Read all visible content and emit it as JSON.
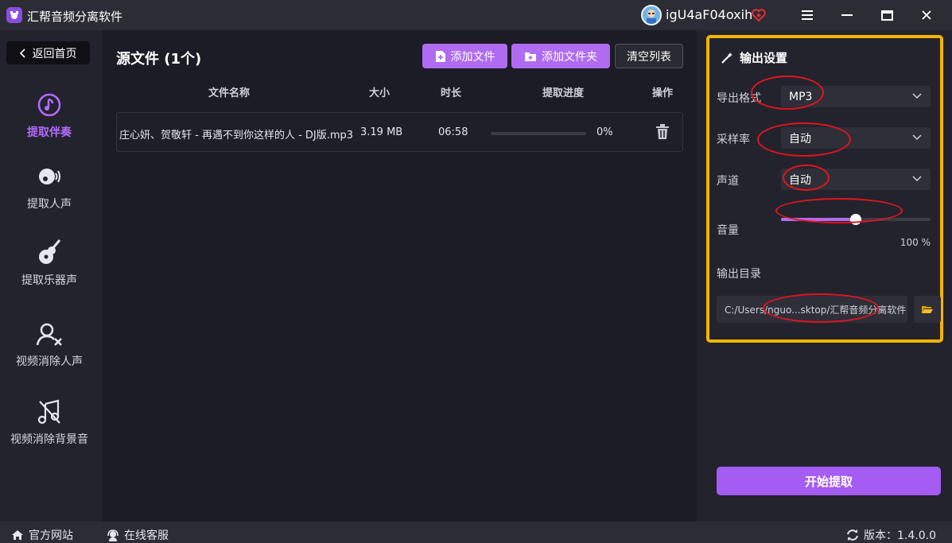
{
  "app": {
    "title": "汇帮音频分离软件"
  },
  "user": {
    "name": "igU4aF04oxih"
  },
  "sidebar": {
    "back_label": "返回首页",
    "items": [
      {
        "label": "提取伴奏",
        "icon": "music-note-icon",
        "active": true
      },
      {
        "label": "提取人声",
        "icon": "voice-icon",
        "active": false
      },
      {
        "label": "提取乐器声",
        "icon": "guitar-icon",
        "active": false
      },
      {
        "label": "视频消除人声",
        "icon": "user-remove-icon",
        "active": false
      },
      {
        "label": "视频消除背景音",
        "icon": "music-off-icon",
        "active": false
      }
    ]
  },
  "main": {
    "title": "源文件 (1个)",
    "buttons": {
      "add_file": "添加文件",
      "add_folder": "添加文件夹",
      "clear_list": "清空列表"
    },
    "columns": {
      "name": "文件名称",
      "size": "大小",
      "duration": "时长",
      "progress": "提取进度",
      "action": "操作"
    },
    "files": [
      {
        "name": "庄心妍、贺敬轩 - 再遇不到你这样的人 - DJ版.mp3",
        "size": "3.19 MB",
        "duration": "06:58",
        "progress_text": "0%",
        "progress": 0
      }
    ]
  },
  "settings": {
    "title": "输出设置",
    "format_label": "导出格式",
    "format_value": "MP3",
    "sample_rate_label": "采样率",
    "sample_rate_value": "自动",
    "channel_label": "声道",
    "channel_value": "自动",
    "volume_label": "音量",
    "volume_text": "100 %",
    "volume_fraction": 0.5,
    "output_dir_label": "输出目录",
    "output_dir_value": "C:/Users/nguo...sktop/汇帮音频分离软件"
  },
  "start_button": "开始提取",
  "footer": {
    "website": "官方网站",
    "support": "在线客服",
    "version": "版本：1.4.0.0"
  },
  "colors": {
    "accent": "#b06cf0",
    "highlight_border": "#f5b400",
    "annotation": "#e0141e"
  }
}
